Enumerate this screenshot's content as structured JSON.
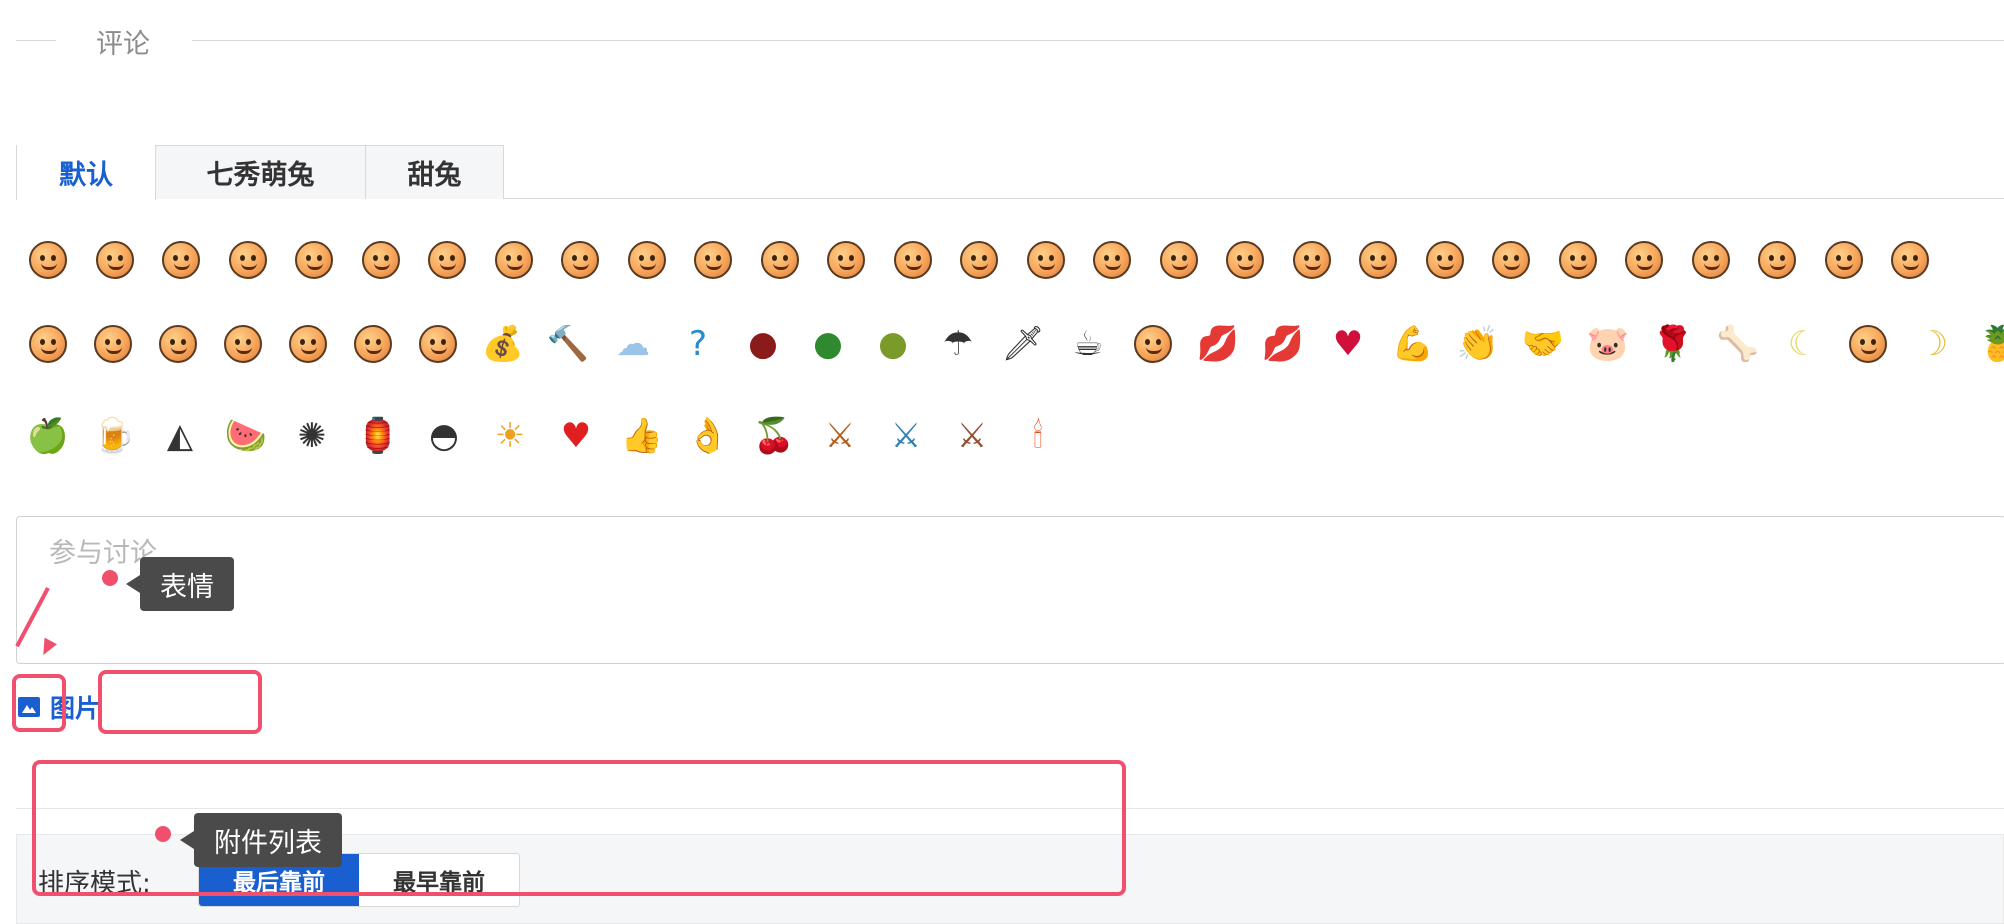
{
  "section": {
    "title": "评论"
  },
  "tabs": [
    {
      "label": "默认",
      "active": true
    },
    {
      "label": "七秀萌兔",
      "active": false
    },
    {
      "label": "甜兔",
      "active": false
    }
  ],
  "emoji_rows": [
    [
      "smile-face",
      "angry-face",
      "crying-face",
      "blush-face",
      "sly-face",
      "grin-face",
      "wink-face",
      "shocked-face",
      "furious-face",
      "dizzy-face",
      "sob-face",
      "kiss-face",
      "sleepy-face",
      "sad-face",
      "confused-face",
      "neutral-face",
      "happy-face",
      "laugh-face",
      "frown-face",
      "pout-face",
      "shy-face",
      "tired-face",
      "mad-face",
      "sulk-face",
      "teeth-face",
      "surprised-face",
      "star-face",
      "ooh-face",
      "grimace-face"
    ],
    [
      "scream-face",
      "sleeping-face",
      "tongue-face",
      "love-face",
      "whistle-face",
      "smug-face",
      "cool-face",
      "money-bag",
      "hammer",
      "cloud",
      "question-mark",
      "red-ball",
      "green-ball",
      "olive-ball",
      "storm",
      "knife",
      "coffee",
      "heart-eyes-face",
      "lips-small",
      "lips",
      "heart",
      "arm",
      "clap",
      "handshake",
      "pig",
      "rose",
      "bone",
      "moon",
      "tiger-face",
      "sun-moon",
      "pineapple"
    ],
    [
      "apple",
      "beer",
      "dumplings",
      "watermelon",
      "firework",
      "lantern",
      "rice-ball",
      "sun-face",
      "red-heart",
      "thumbs-up",
      "ok-hand",
      "cherries",
      "warrior-1",
      "warrior-2",
      "warrior-3",
      "candle"
    ]
  ],
  "comment": {
    "placeholder": "参与讨论..."
  },
  "toolbar": {
    "image_label": "图片"
  },
  "sort": {
    "label": "排序模式:",
    "options": [
      {
        "label": "最后靠前",
        "active": true
      },
      {
        "label": "最早靠前",
        "active": false
      }
    ]
  },
  "annotations": {
    "emoji_tip": "表情",
    "attachments_tip": "附件列表",
    "accent_color": "#f0506e"
  },
  "colors": {
    "brand": "#1a5fd0"
  }
}
